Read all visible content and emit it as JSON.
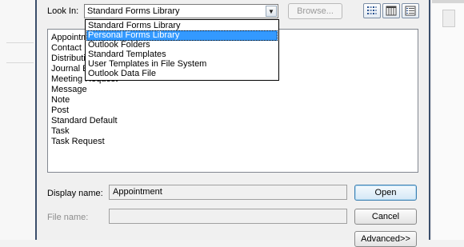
{
  "dialog": {
    "look_in_label": "Look In:",
    "look_in_value": "Standard Forms Library",
    "browse_label": "Browse...",
    "view_icons": [
      "list-view-icon",
      "details-view-icon",
      "properties-view-icon"
    ]
  },
  "dropdown": {
    "options": [
      "Standard Forms Library",
      "Personal Forms Library",
      "Outlook Folders",
      "Standard Templates",
      "User Templates in File System",
      "Outlook Data File"
    ],
    "selected_index": 1
  },
  "form_list": {
    "items": [
      "Appointment",
      "Contact",
      "Distribution List",
      "Journal Entry",
      "Meeting Request",
      "Message",
      "Note",
      "Post",
      "Standard Default",
      "Task",
      "Task Request"
    ]
  },
  "fields": {
    "display_name_label": "Display name:",
    "display_name_value": "Appointment",
    "file_name_label": "File name:",
    "file_name_value": ""
  },
  "buttons": {
    "open": "Open",
    "cancel": "Cancel",
    "advanced": "Advanced>>"
  },
  "colors": {
    "selection": "#3399ff",
    "dialog_bg": "#f0f0f0",
    "border": "#3a4e6b"
  }
}
